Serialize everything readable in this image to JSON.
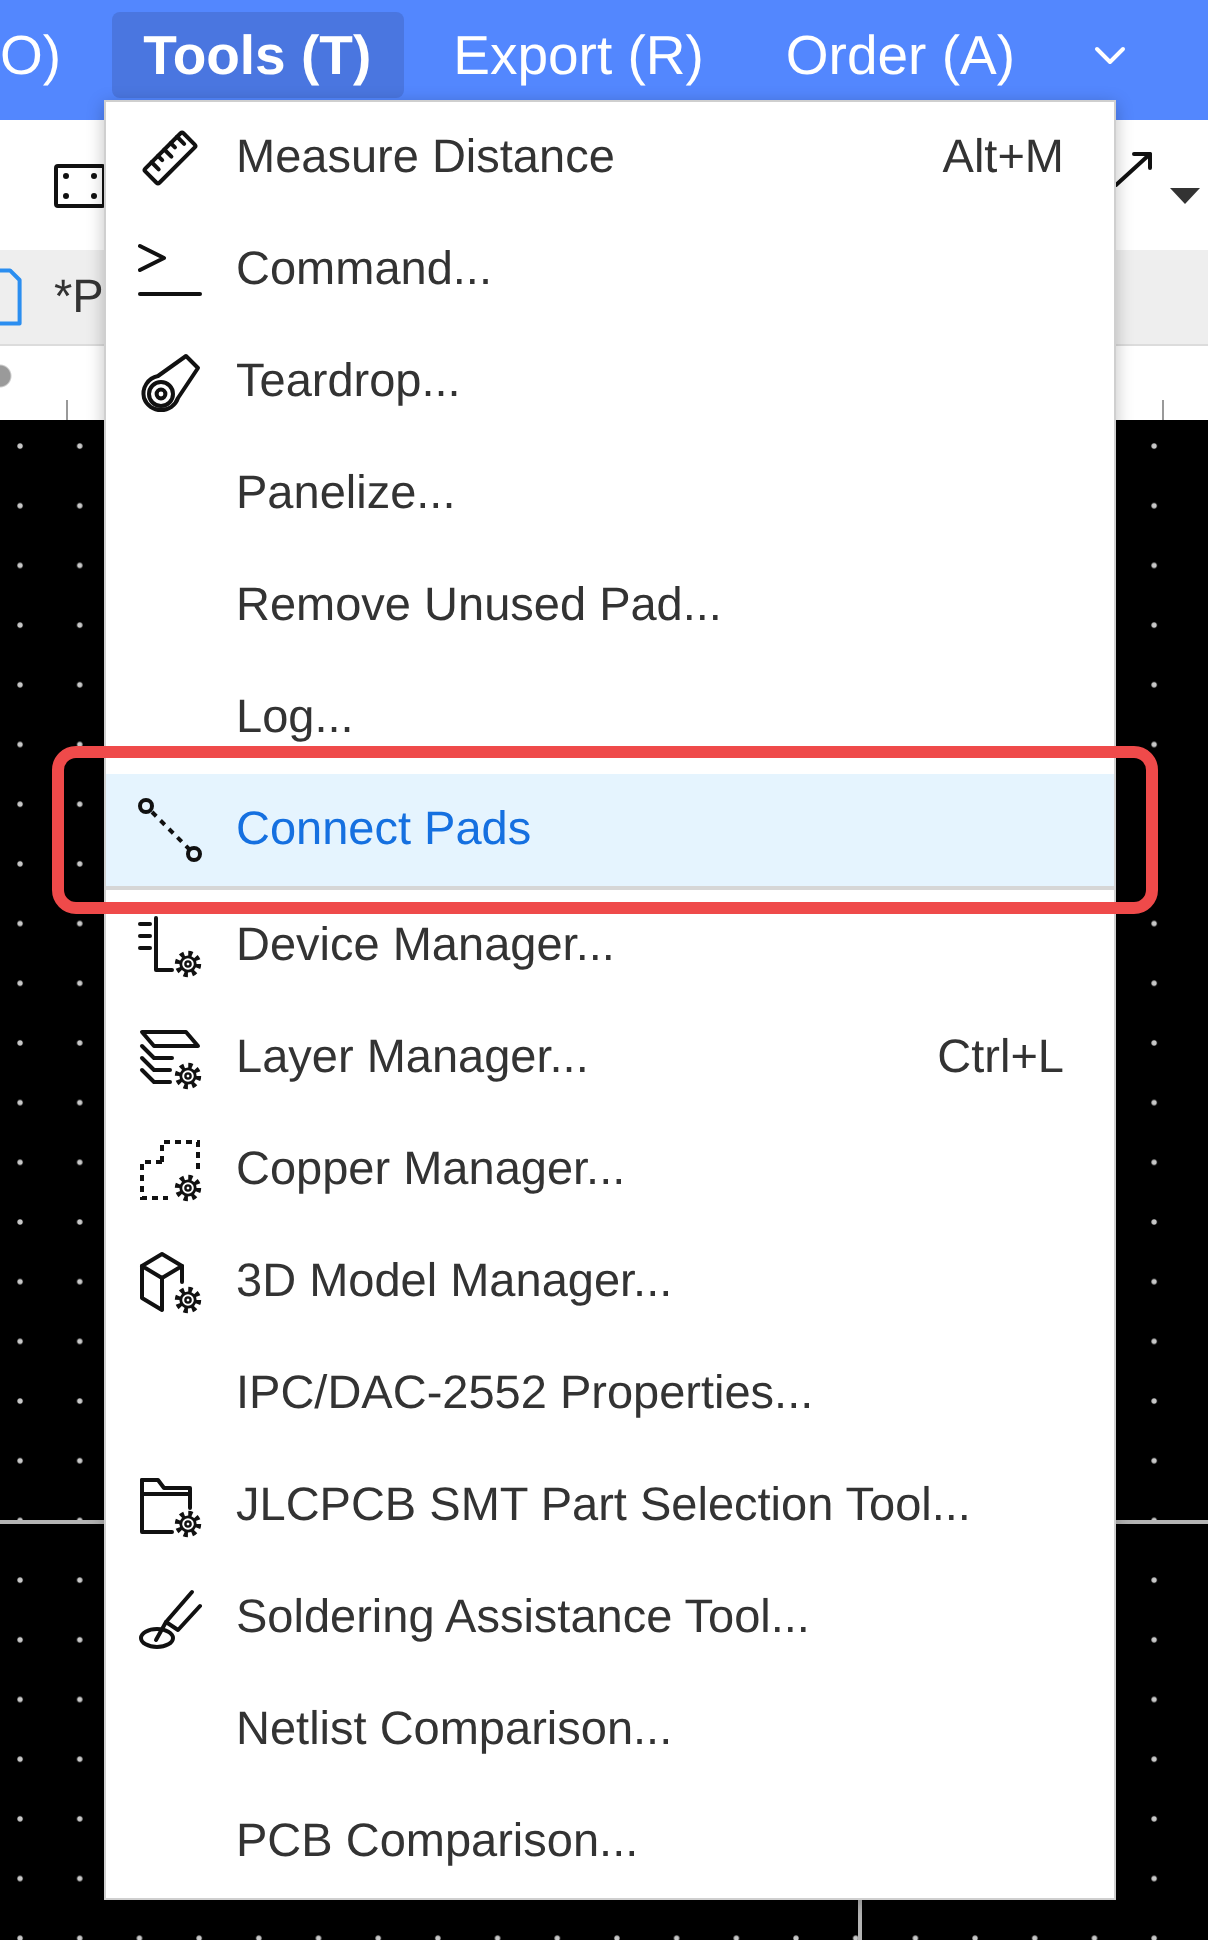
{
  "menubar": {
    "items": [
      {
        "label": "O)",
        "selected": false
      },
      {
        "label": "Tools (T)",
        "selected": true
      },
      {
        "label": "Export (R)",
        "selected": false
      },
      {
        "label": "Order (A)",
        "selected": false
      }
    ]
  },
  "tabs": [
    {
      "label": "*P"
    }
  ],
  "menu": {
    "sections": [
      {
        "items": [
          {
            "label": "Measure Distance",
            "shortcut": "Alt+M",
            "selected": false,
            "annotated": false
          },
          {
            "label": "Command...",
            "selected": false,
            "annotated": false
          },
          {
            "label": "Teardrop...",
            "selected": false,
            "annotated": false
          },
          {
            "label": "Panelize...",
            "selected": false,
            "annotated": false
          },
          {
            "label": "Remove Unused Pad...",
            "selected": false,
            "annotated": false
          },
          {
            "label": "Log...",
            "selected": false,
            "annotated": false
          },
          {
            "label": "Connect Pads",
            "selected": true,
            "annotated": true
          }
        ]
      },
      {
        "items": [
          {
            "label": "Device Manager...",
            "selected": false,
            "annotated": false
          },
          {
            "label": "Layer Manager...",
            "shortcut": "Ctrl+L",
            "selected": false,
            "annotated": false
          },
          {
            "label": "Copper Manager...",
            "selected": false,
            "annotated": false
          },
          {
            "label": "3D Model Manager...",
            "selected": false,
            "annotated": false
          },
          {
            "label": "IPC/DAC-2552 Properties...",
            "selected": false,
            "annotated": false
          },
          {
            "label": "JLCPCB SMT Part Selection Tool...",
            "selected": false,
            "annotated": false
          },
          {
            "label": "Soldering Assistance Tool...",
            "selected": false,
            "annotated": false
          },
          {
            "label": "Netlist Comparison...",
            "selected": false,
            "annotated": false
          },
          {
            "label": "PCB Comparison...",
            "selected": false,
            "annotated": false
          }
        ]
      }
    ]
  }
}
